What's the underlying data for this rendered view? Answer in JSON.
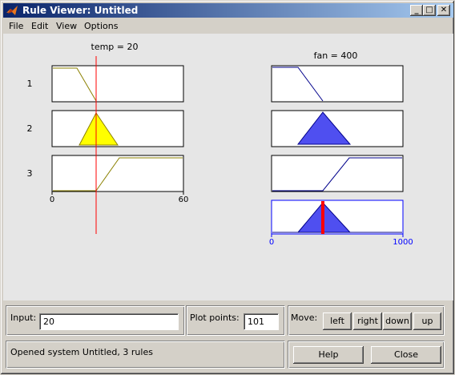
{
  "window": {
    "title": "Rule Viewer: Untitled",
    "minimize_label": "_",
    "maximize_label": "□",
    "close_label": "✕"
  },
  "menu": [
    "File",
    "Edit",
    "View",
    "Options"
  ],
  "plot": {
    "input_header": "temp = 20",
    "output_header": "fan = 400",
    "rule_labels": [
      "1",
      "2",
      "3"
    ],
    "input_range": [
      0,
      60
    ],
    "output_range": [
      0,
      1000
    ],
    "input_value": 20,
    "output_value": 400,
    "input_tick_labels": [
      "0",
      "60"
    ],
    "output_tick_labels": [
      "0",
      "1000"
    ],
    "colors": {
      "input_fill": "#ffff00",
      "input_curve": "#8b8000",
      "output_fill": "#4f4ff0",
      "output_curve": "#00008b",
      "marker": "#ff0000",
      "output_axis": "#0000ff"
    }
  },
  "input_panel": {
    "label": "Input:",
    "value": "20"
  },
  "plot_points": {
    "label": "Plot points:",
    "value": "101"
  },
  "move": {
    "label": "Move:",
    "buttons": [
      "left",
      "right",
      "down",
      "up"
    ]
  },
  "status": "Opened system Untitled, 3 rules",
  "actions": {
    "help_label": "Help",
    "close_label": "Close"
  }
}
